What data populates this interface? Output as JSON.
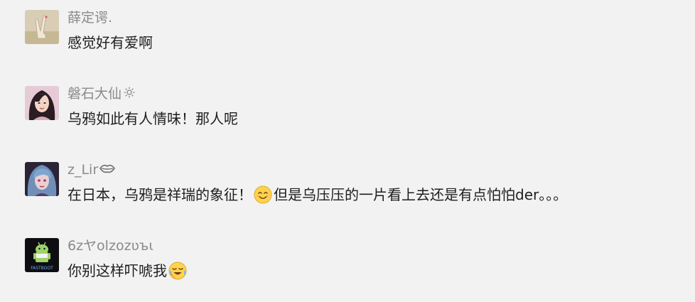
{
  "comments": [
    {
      "username": "薛定谔.",
      "message": "感觉好有爱啊",
      "avatar": "avatar-peace-hand"
    },
    {
      "username": "磐石大仙",
      "badge_icon": "gear-flower-icon",
      "message": "乌鸦如此有人情味！那人呢",
      "avatar": "avatar-woman-portrait"
    },
    {
      "username": "z_Lir",
      "badge_icon": "lips-icon",
      "message_before": "在日本，乌鸦是祥瑞的象征！",
      "emoji": "smile-emoji-icon",
      "message_after": "但是乌压压的一片看上去还是有点怕怕der。。。",
      "avatar": "avatar-anime-girl"
    },
    {
      "username": "6zヤolzozʋъι",
      "message_before": "你别这样吓唬我",
      "emoji": "crying-laugh-emoji-icon",
      "avatar": "avatar-fastboot-android"
    }
  ],
  "avatar_badge_text": "FASTBOOT"
}
